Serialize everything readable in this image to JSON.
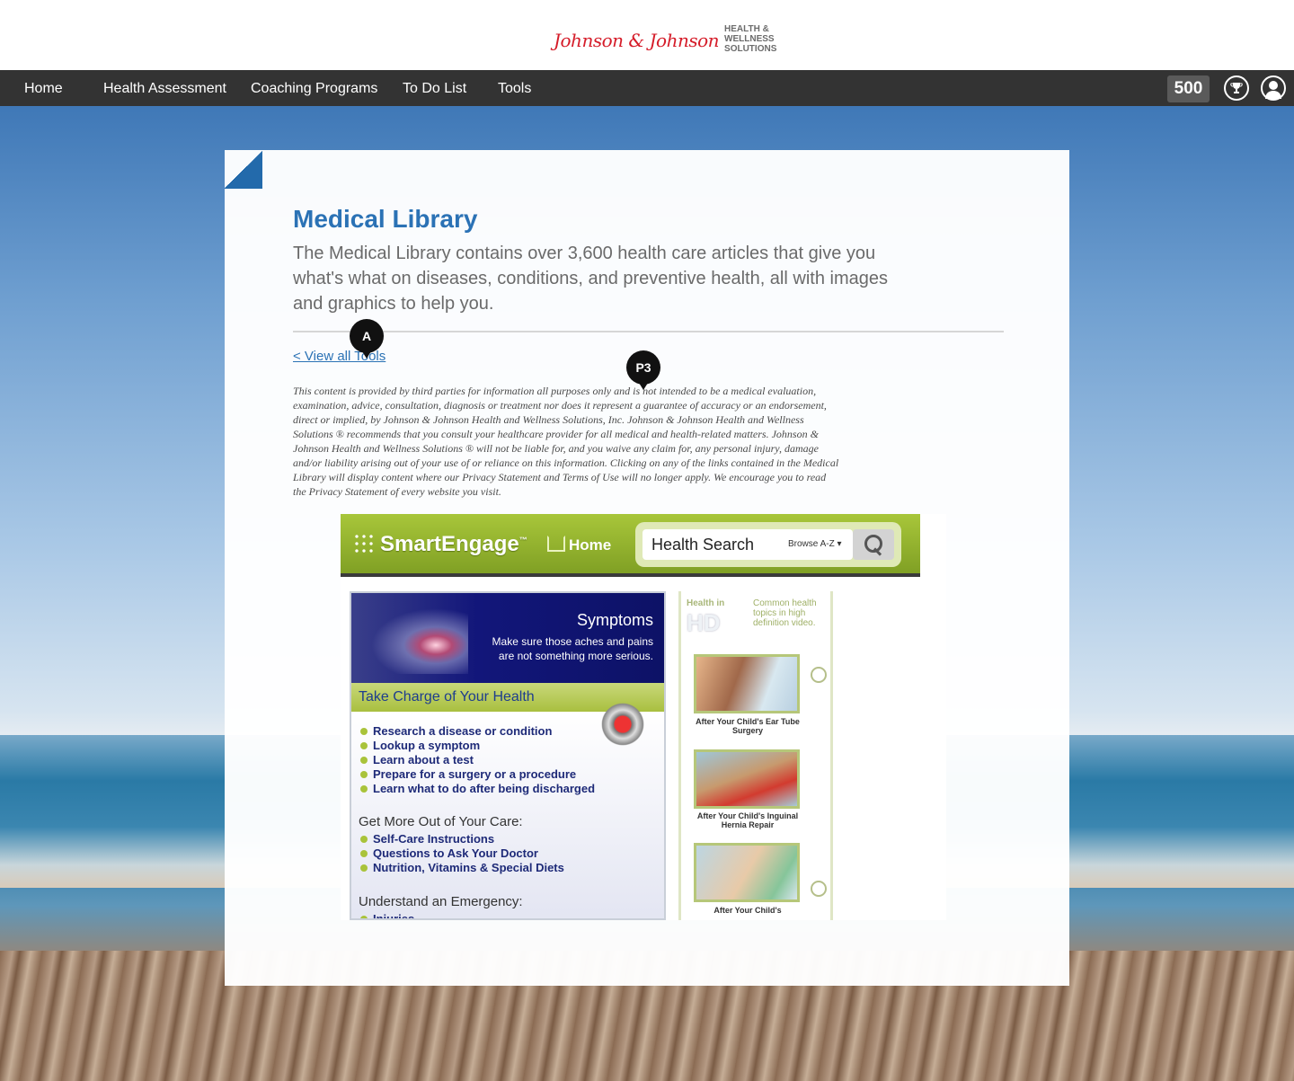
{
  "header": {
    "brand_name": "Johnson & Johnson",
    "brand_sub": [
      "HEALTH &",
      "WELLNESS",
      "SOLUTIONS"
    ]
  },
  "nav": {
    "items": [
      {
        "label": "Home"
      },
      {
        "label": "Health Assessment"
      },
      {
        "label": "Coaching Programs"
      },
      {
        "label": "To Do List"
      },
      {
        "label": "Tools"
      }
    ],
    "points": "500",
    "trophy_icon": "trophy-icon",
    "profile_icon": "user-avatar-icon"
  },
  "page": {
    "title": "Medical Library",
    "lead": "The Medical Library contains over 3,600 health care articles that give you what's what on diseases, conditions, and preventive health, all with images and graphics to help you.",
    "back_link": "< View all Tools",
    "disclaimer": "This content is provided by third parties for information all purposes only and is not intended to be a medical evaluation, examination, advice, consultation, diagnosis or treatment nor does it represent a guarantee of accuracy or an endorsement, direct or implied, by Johnson & Johnson Health and Wellness Solutions, Inc. Johnson & Johnson Health and Wellness Solutions ® recommends that you consult your healthcare provider for all medical and health-related matters. Johnson & Johnson Health and Wellness Solutions ® will not be liable for, and you waive any claim for, any personal injury, damage and/or liability arising out of your use of or reliance on this information. Clicking on any of the links contained in the Medical Library will display content where our Privacy Statement and Terms of Use will no longer apply. We encourage you to read the Privacy Statement of every website you visit."
  },
  "pins": {
    "a": "A",
    "p3": "P3"
  },
  "embed": {
    "logo": "SmartEngage",
    "tm": "™",
    "home": "Home",
    "search": "Health Search",
    "browse": "Browse A-Z ▾",
    "hero_title": "Symptoms",
    "hero_sub": [
      "Make sure those aches and pains",
      "are not something more serious."
    ],
    "charge": "Take Charge of Your Health",
    "list1": [
      "Research a disease or condition",
      "Lookup a symptom",
      "Learn about a test",
      "Prepare for a surgery or a procedure",
      "Learn what to do after being discharged"
    ],
    "sec2": "Get More Out of Your Care:",
    "list2": [
      "Self-Care Instructions",
      "Questions to Ask Your Doctor",
      "Nutrition, Vitamins & Special Diets"
    ],
    "sec3": "Understand an Emergency:",
    "list3": [
      "Injuries"
    ],
    "hd_small": "Health in",
    "hd_big": "HD",
    "hd_note": "Common health topics in high definition video.",
    "videos": [
      {
        "caption": "After Your Child's Ear Tube Surgery"
      },
      {
        "caption": "After Your Child's Inguinal Hernia Repair"
      },
      {
        "caption": "After Your Child's"
      }
    ]
  },
  "colors": {
    "nav_bg": "#333333",
    "accent": "#2b72b5",
    "brand_red": "#d51c29",
    "smartengage_green": "#a8c63a"
  }
}
